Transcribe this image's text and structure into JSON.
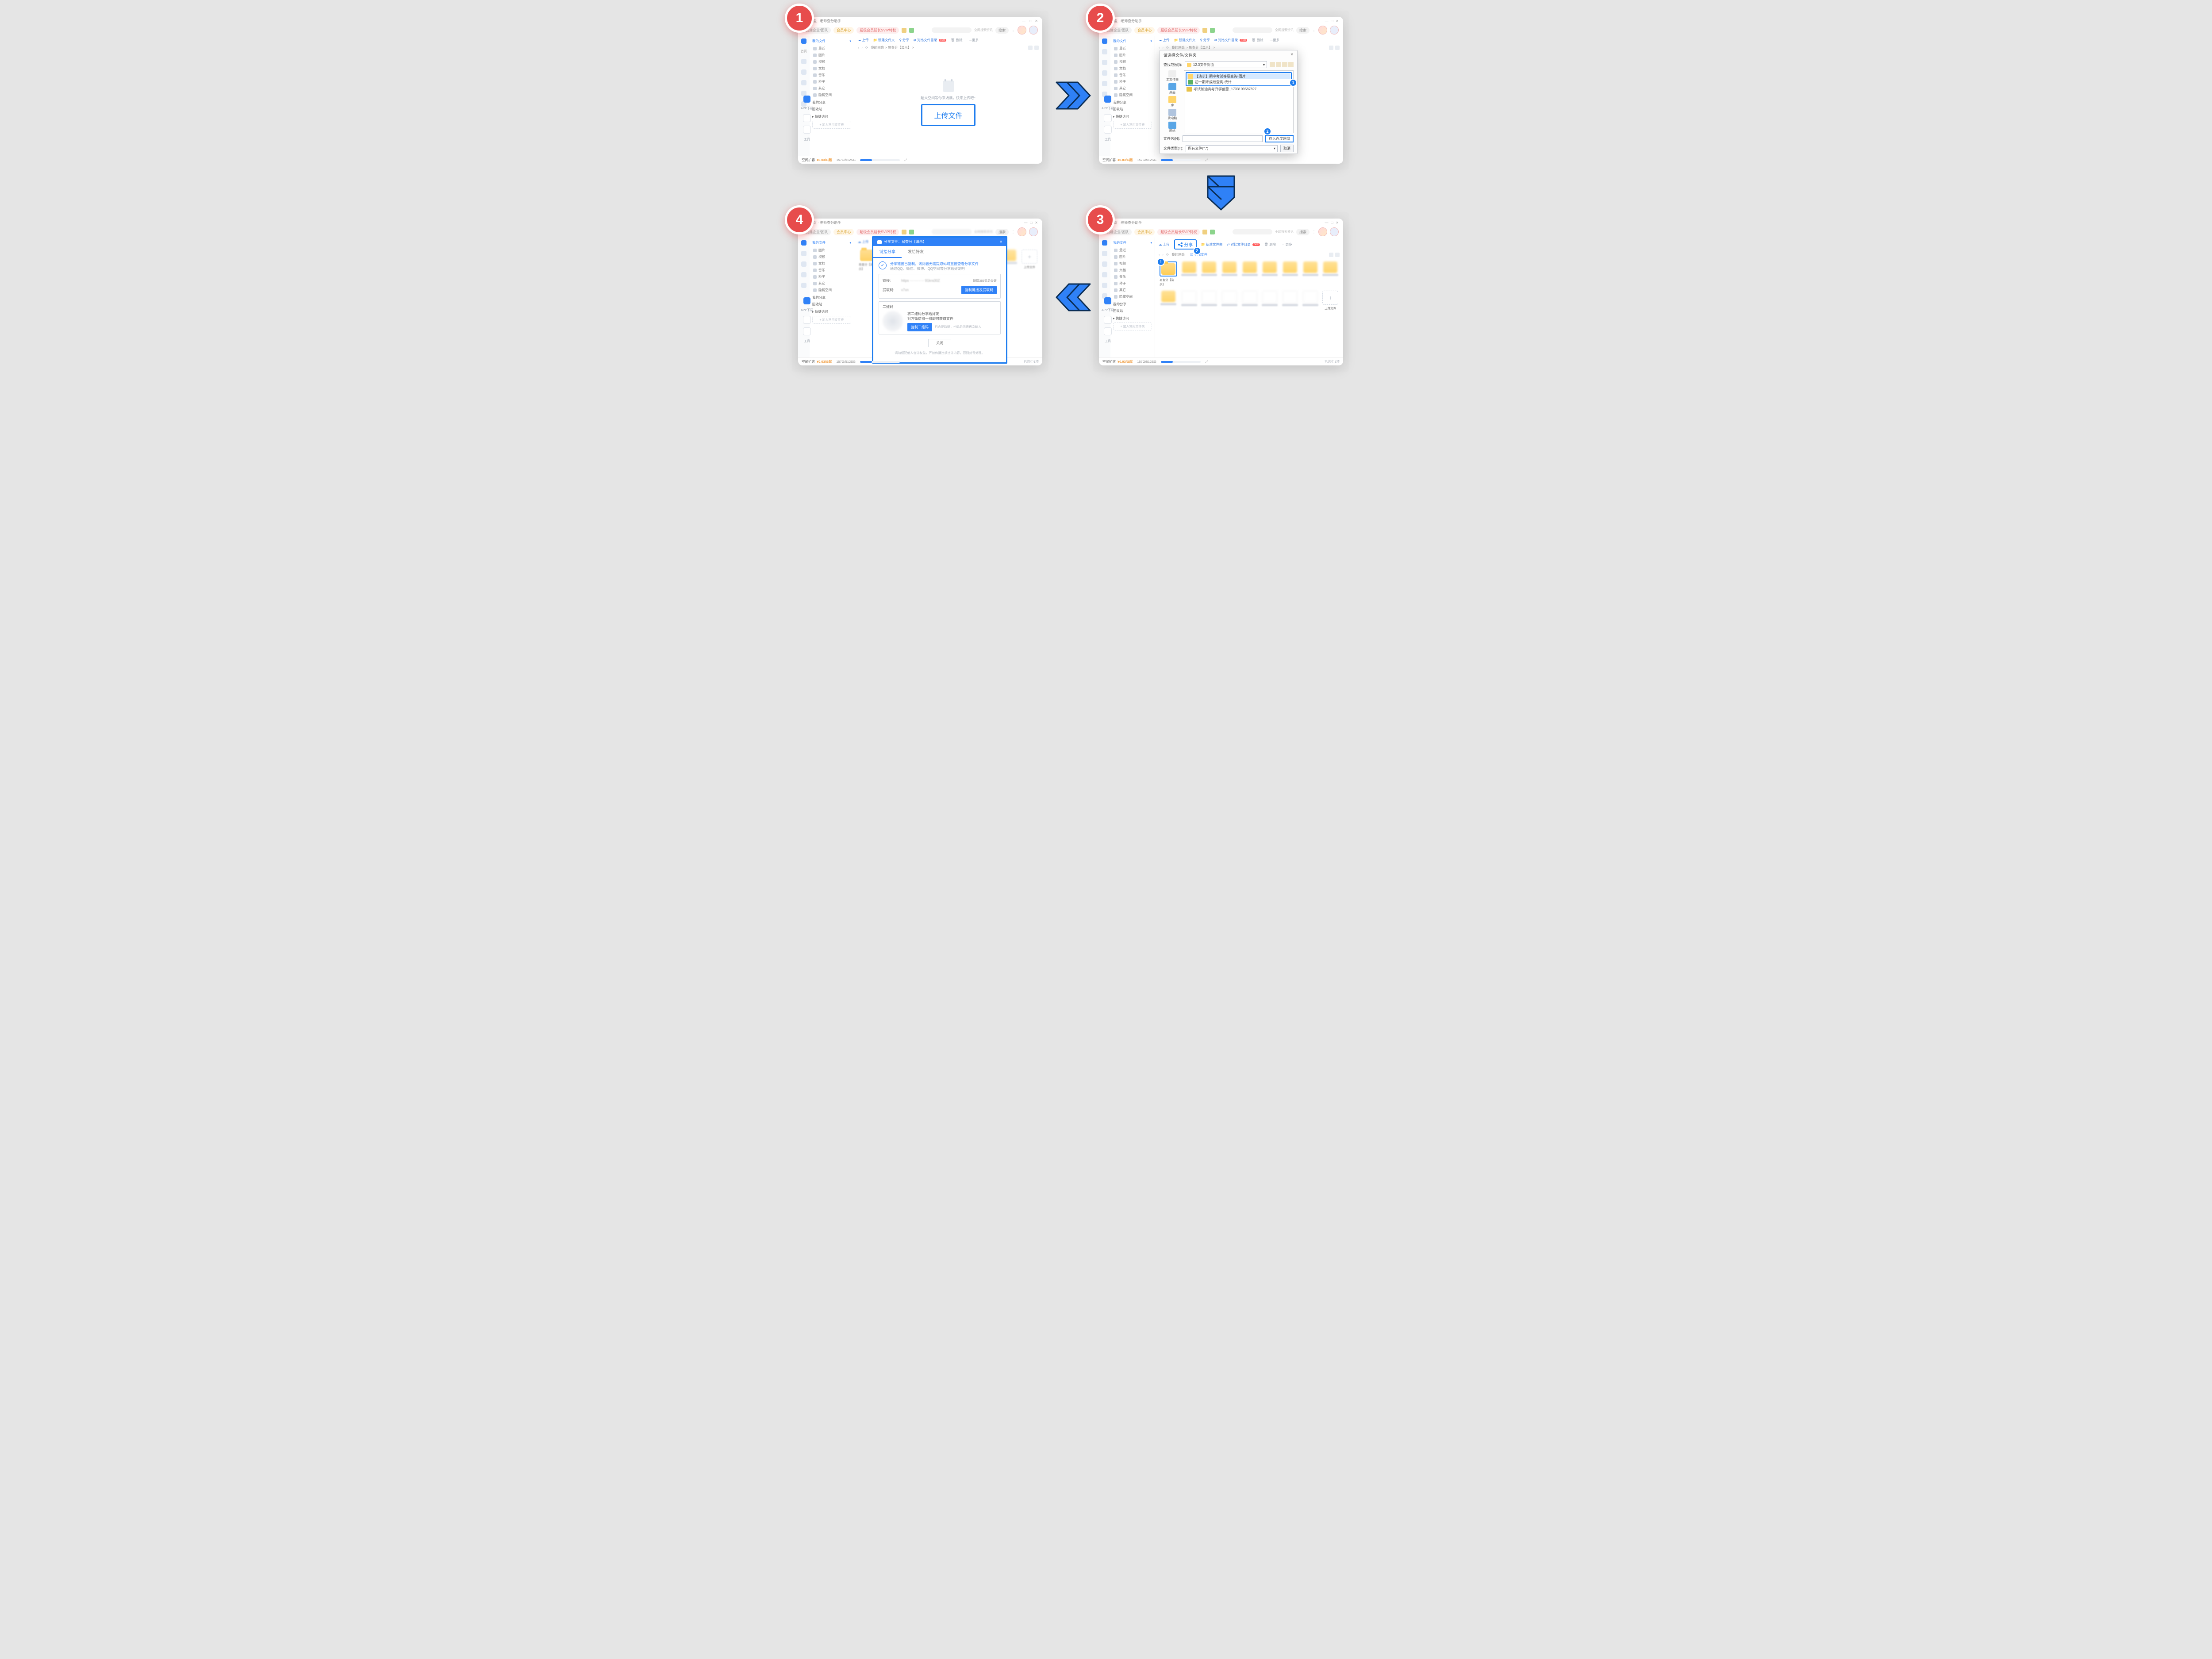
{
  "steps": {
    "s1": "1",
    "s2": "2",
    "s3": "3",
    "s4": "4"
  },
  "badges": {
    "b1": "1",
    "b2": "2"
  },
  "window": {
    "title_app": "百度网盘",
    "title_suffix": "· 老师查分助手",
    "min": "—",
    "max": "□",
    "close": "✕"
  },
  "topstrip": {
    "create": "创建企业/团队",
    "member": "会员中心",
    "promo": "超级会员延长SVIP特权",
    "search_btn": "搜索",
    "search_ph1": "搜网盘文件",
    "search_ph2": "全网搜索资讯",
    "dots": "⋮"
  },
  "sidebar": {
    "head": "我的文件",
    "items": [
      "最近",
      "图片",
      "视频",
      "文档",
      "音乐",
      "种子",
      "其它"
    ],
    "hidden": "隐藏空间",
    "myshare": "我的分享",
    "recycle": "回收站",
    "quick": "快捷访问",
    "quick_add": "+ 加入常用文件夹"
  },
  "rail": {
    "items": [
      "首页",
      "传输",
      "消息",
      "相册",
      "AI工具",
      "好友"
    ]
  },
  "actionbar": {
    "upload": "上传",
    "share": "分享",
    "newfolder": "新建文件夹",
    "compare": "对比文件目录",
    "new_badge": "new",
    "delete": "删除",
    "more": "···更多"
  },
  "pathbar": {
    "back": "‹",
    "fwd": "›",
    "refresh": "⟳",
    "crumb1": "我的网盘",
    "crumb2": "易查分【演示】",
    "sep": ">"
  },
  "stage": {
    "empty_text": "超大空间等你来填满，快来上传吧~",
    "upload_btn": "上传文件"
  },
  "footer": {
    "quota_label": "空间扩容",
    "quota_num": "¥0.03/G起",
    "quota_used": "157G/512SG",
    "quota_expand": "⤢"
  },
  "app": {
    "l1": "APP下载",
    "l2": "工具"
  },
  "dialog": {
    "title": "请选择文件/文件夹",
    "lookin": "查找范围(I):",
    "folder": "12.3文件封面",
    "items": [
      "【演示】期中考试等级查询-图片",
      "初一期末成绩查询-统计",
      "考试加油高考升学创意_1733199587827"
    ],
    "places": [
      "主文件夹",
      "桌面",
      "库",
      "此电脑",
      "网络"
    ],
    "filename": "文件名(N):",
    "filetype": "文件类型(T):",
    "filetype_val": "所有文件(*.*)",
    "save": "存入百度网盘",
    "cancel": "取消"
  },
  "grid": {
    "all_files": "全部文件",
    "folder_demo": "易查分【演示】",
    "upload_cell": "+",
    "upload_label": "上传文件",
    "footer_right": "已选中1项"
  },
  "share": {
    "title_prefix": "分享文件：",
    "title_name": "易查分【演示】",
    "close": "✕",
    "tab1": "链接分享",
    "tab2": "发给好友",
    "success_line1": "分享链接已复制，访问者无需提取码可直接查看分享文件",
    "success_line2": "通过QQ、微信、微博、QQ空间等分享给好友吧",
    "link_label": "链接:",
    "link_val": "https",
    "link_tail": "91kra30Z",
    "expire": "链接365天后失效",
    "pwd_label": "提取码:",
    "pwd_val": "v7xn",
    "copy_link_btn": "复制链接及提取码",
    "qr_label": "二维码",
    "qr_line1": "将二维码分享给好友",
    "qr_line2": "对方微信扫一扫即可获取文件",
    "copy_qr_btn": "复制二维码",
    "qr_hint": "已含提取码，扫码后无需再次输入",
    "close_btn": "关闭",
    "footnote": "请勿侵犯他人合法权益，严禁传播违禁违法内容，否则封号处理。"
  }
}
